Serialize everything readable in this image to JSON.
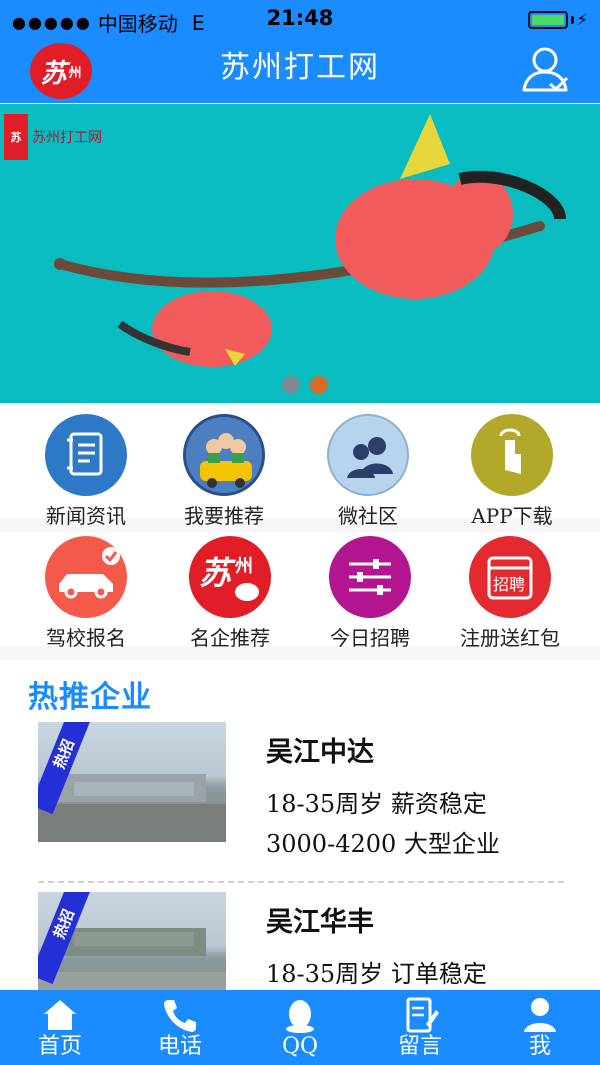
{
  "status_bar": {
    "signal": "●●●●●",
    "carrier": "中国移动",
    "network": "E",
    "time": "21:48",
    "charging": "⚡"
  },
  "header": {
    "title": "苏州打工网",
    "logo_main": "苏",
    "logo_sub": "州"
  },
  "banner": {
    "logo_square": "苏",
    "logo_text": "苏州打工网",
    "slides": 2,
    "active_slide": 2
  },
  "grid": [
    {
      "label": "新闻资讯",
      "icon": "notebook-icon",
      "color": "#2e78c8"
    },
    {
      "label": "我要推荐",
      "icon": "people-car-icon",
      "color": "#4c7fbf"
    },
    {
      "label": "微社区",
      "icon": "community-icon",
      "color": "#b8d4ec"
    },
    {
      "label": "APP下载",
      "icon": "tap-icon",
      "color": "#b2a82a"
    },
    {
      "label": "驾校报名",
      "icon": "car-icon",
      "color": "#f45a4a"
    },
    {
      "label": "名企推荐",
      "icon": "suzhou-logo-icon",
      "color": "#e11d28"
    },
    {
      "label": "今日招聘",
      "icon": "sliders-icon",
      "color": "#b2158f"
    },
    {
      "label": "注册送红包",
      "icon": "red-envelope-icon",
      "color": "#e22a30"
    }
  ],
  "section": {
    "title": "热推企业"
  },
  "companies": [
    {
      "ribbon": "热招",
      "name": "吴江中达",
      "line1": "18-35周岁 薪资稳定",
      "line2": "3000-4200 大型企业"
    },
    {
      "ribbon": "热招",
      "name": "吴江华丰",
      "line1": "18-35周岁 订单稳定",
      "line2": ""
    }
  ],
  "tabs": [
    {
      "label": "首页",
      "icon": "home-icon"
    },
    {
      "label": "电话",
      "icon": "phone-icon"
    },
    {
      "label": "QQ",
      "icon": "qq-icon"
    },
    {
      "label": "留言",
      "icon": "message-icon"
    },
    {
      "label": "我",
      "icon": "user-icon"
    }
  ],
  "colors": {
    "primary": "#1a8cff",
    "banner_bg": "#08bcc0",
    "accent_red": "#e11d28"
  }
}
